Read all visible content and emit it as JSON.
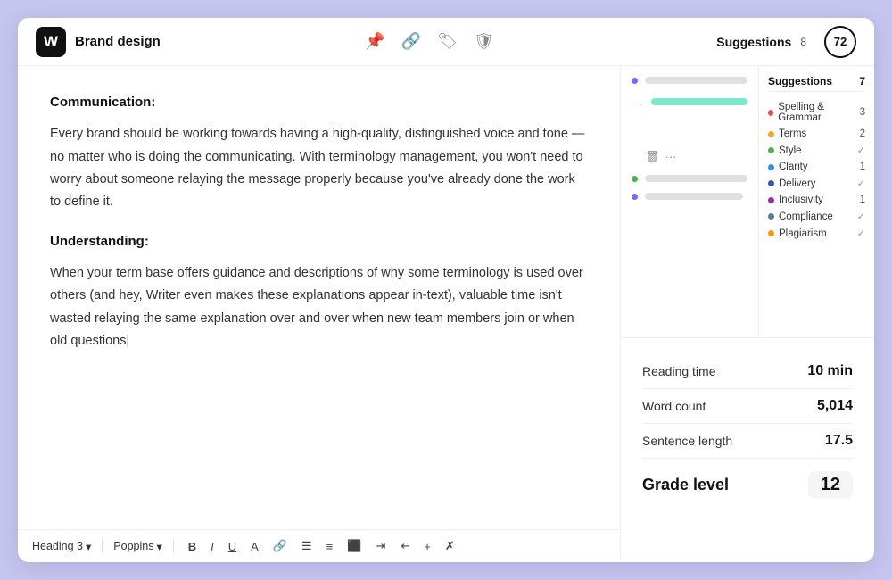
{
  "header": {
    "logo_text": "W",
    "title": "Brand design",
    "suggestions_label": "Suggestions",
    "suggestions_count": "8",
    "score": "72"
  },
  "toolbar": {
    "heading_label": "Heading 3",
    "font_label": "Poppins",
    "bold": "B",
    "italic": "I",
    "underline": "U"
  },
  "editor": {
    "section1_heading": "Communication:",
    "section1_para": "Every brand should be working towards having a high-quality, distinguished voice and tone — no matter who is doing the communicating. With terminology management, you won't need to worry about someone relaying the message properly because you've already done the work to define it.",
    "section2_heading": "Understanding:",
    "section2_para": "When your term base offers guidance and descriptions of why some terminology is used over others (and hey, Writer even makes these explanations appear in-text), valuable time isn't wasted relaying the same explanation over and over when new team members join or when old questions|"
  },
  "suggestions_panel": {
    "categories_header": "Suggestions",
    "categories_count": "7",
    "categories": [
      {
        "name": "Spelling & Grammar",
        "count": "3",
        "color": "#e94f4f"
      },
      {
        "name": "Terms",
        "count": "2",
        "color": "#f5a623"
      },
      {
        "name": "Style",
        "check": true,
        "color": "#4caf50"
      },
      {
        "name": "Clarity",
        "count": "1",
        "color": "#2196f3"
      },
      {
        "name": "Delivery",
        "check": true,
        "color": "#3f51b5"
      },
      {
        "name": "Inclusivity",
        "count": "1",
        "color": "#9c27b0"
      },
      {
        "name": "Compliance",
        "check": true,
        "color": "#607d8b"
      },
      {
        "name": "Plagiarism",
        "check": true,
        "color": "#ff9800"
      }
    ]
  },
  "stats": {
    "reading_time_label": "Reading time",
    "reading_time_value": "10 min",
    "word_count_label": "Word count",
    "word_count_value": "5,014",
    "sentence_length_label": "Sentence length",
    "sentence_length_value": "17.5",
    "grade_level_label": "Grade level",
    "grade_level_value": "12"
  },
  "colors": {
    "dot_purple": "#7b68ee",
    "dot_green": "#4caf50",
    "dot_red": "#e94f4f",
    "dot_orange": "#f5a623",
    "highlight": "#7de8d0"
  }
}
